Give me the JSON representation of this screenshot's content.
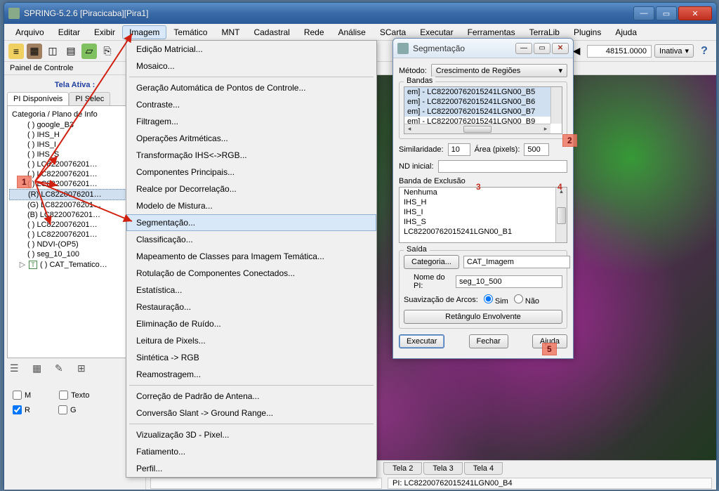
{
  "window": {
    "title": "SPRING-5.2.6 [Piracicaba][Pira1]"
  },
  "menu": {
    "items": [
      "Arquivo",
      "Editar",
      "Exibir",
      "Imagem",
      "Temático",
      "MNT",
      "Cadastral",
      "Rede",
      "Análise",
      "SCarta",
      "Executar",
      "Ferramentas",
      "TerraLib",
      "Plugins",
      "Ajuda"
    ],
    "active_index": 3
  },
  "toolbar": {
    "coord": "48151.0000",
    "state_combo": "Inativa"
  },
  "control_panel": {
    "header": "Painel de Controle",
    "tela_ativa": "Tela Ativa :",
    "tabs": [
      "PI Disponíveis",
      "PI Selec"
    ],
    "tree_title": "Categoria / Plano de Info",
    "tree_items": [
      "( ) google_B3",
      "( ) IHS_H",
      "( ) IHS_I",
      "( ) IHS_S",
      "( ) LC8220076201…",
      "( ) LC8220076201…",
      "( ) LC8220076201…",
      "(R) LC8220076201…",
      "(G) LC8220076201…",
      "(B) LC8220076201…",
      "( ) LC8220076201…",
      "( ) LC8220076201…",
      "( ) NDVI-(OP5)",
      "( ) seg_10_100",
      "( ) CAT_Tematico…"
    ],
    "selected_index": 7,
    "check_m": "M",
    "check_texto": "Texto",
    "check_r": "R",
    "check_g": "G"
  },
  "dropdown": {
    "groups": [
      [
        "Edição Matricial...",
        "Mosaico..."
      ],
      [
        "Geração Automática de Pontos de Controle...",
        "Contraste...",
        "Filtragem...",
        "Operações Aritméticas...",
        "Transformação IHS<->RGB...",
        "Componentes Principais...",
        "Realce por Decorrelação...",
        "Modelo de Mistura...",
        "Segmentação...",
        "Classificação...",
        "Mapeamento de Classes para Imagem Temática...",
        "Rotulação de Componentes Conectados...",
        "Estatística...",
        "Restauração...",
        "Eliminação de Ruído...",
        "Leitura de Pixels...",
        "Sintética -> RGB",
        "Reamostragem..."
      ],
      [
        "Correção de Padrão de Antena...",
        "Conversão Slant -> Ground Range..."
      ],
      [
        "Vizualização 3D - Pixel...",
        "Fatiamento...",
        "Perfil..."
      ]
    ],
    "highlight": "Segmentação..."
  },
  "seg": {
    "title": "Segmentação",
    "method_label": "Método:",
    "method_value": "Crescimento de Regiões",
    "bands_label": "Bandas",
    "bands": [
      "em] - LC82200762015241LGN00_B5",
      "em] - LC82200762015241LGN00_B6",
      "em] - LC82200762015241LGN00_B7",
      "em] - LC82200762015241LGN00_B9"
    ],
    "sim_label": "Similaridade:",
    "sim_value": "10",
    "area_label": "Área (pixels):",
    "area_value": "500",
    "nd_label": "ND inicial:",
    "nd_value": "",
    "exclusion_label": "Banda de Exclusão",
    "exclusion_items": [
      "Nenhuma",
      "IHS_H",
      "IHS_I",
      "IHS_S",
      "LC82200762015241LGN00_B1"
    ],
    "output_label": "Saída",
    "cat_button": "Categoria...",
    "cat_value": "CAT_Imagem",
    "pi_label": "Nome do PI:",
    "pi_value": "seg_10_500",
    "smooth_label": "Suavização de Arcos:",
    "smooth_yes": "Sim",
    "smooth_no": "Não",
    "bbox_button": "Retângulo Envolvente",
    "exec": "Executar",
    "close": "Fechar",
    "help": "Ajuda"
  },
  "canvas": {
    "tabs": [
      "Tela 2",
      "Tela 3",
      "Tela 4"
    ],
    "status_pi": "PI: LC82200762015241LGN00_B4"
  },
  "markers": {
    "m1": "1",
    "m2": "2",
    "m3": "3",
    "m4": "4",
    "m5": "5"
  }
}
